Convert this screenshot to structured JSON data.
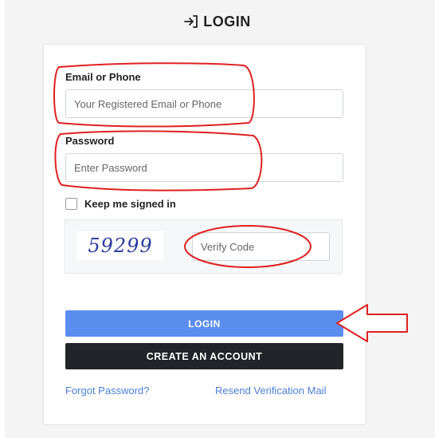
{
  "header": {
    "title": "LOGIN",
    "icon": "login-arrow-icon"
  },
  "form": {
    "email_label": "Email or Phone",
    "email_placeholder": "Your Registered Email or Phone",
    "password_label": "Password",
    "password_placeholder": "Enter Password",
    "remember_label": "Keep me signed in",
    "remember_checked": false,
    "captcha_text": "59299",
    "verify_placeholder": "Verify Code"
  },
  "buttons": {
    "login": "LOGIN",
    "create_account": "CREATE AN ACCOUNT"
  },
  "links": {
    "forgot": "Forgot Password?",
    "resend": "Resend Verification Mail"
  },
  "colors": {
    "login_button": "#5b8def",
    "create_button": "#212428",
    "annotation_red": "#e02020",
    "link": "#4d7fd6"
  }
}
